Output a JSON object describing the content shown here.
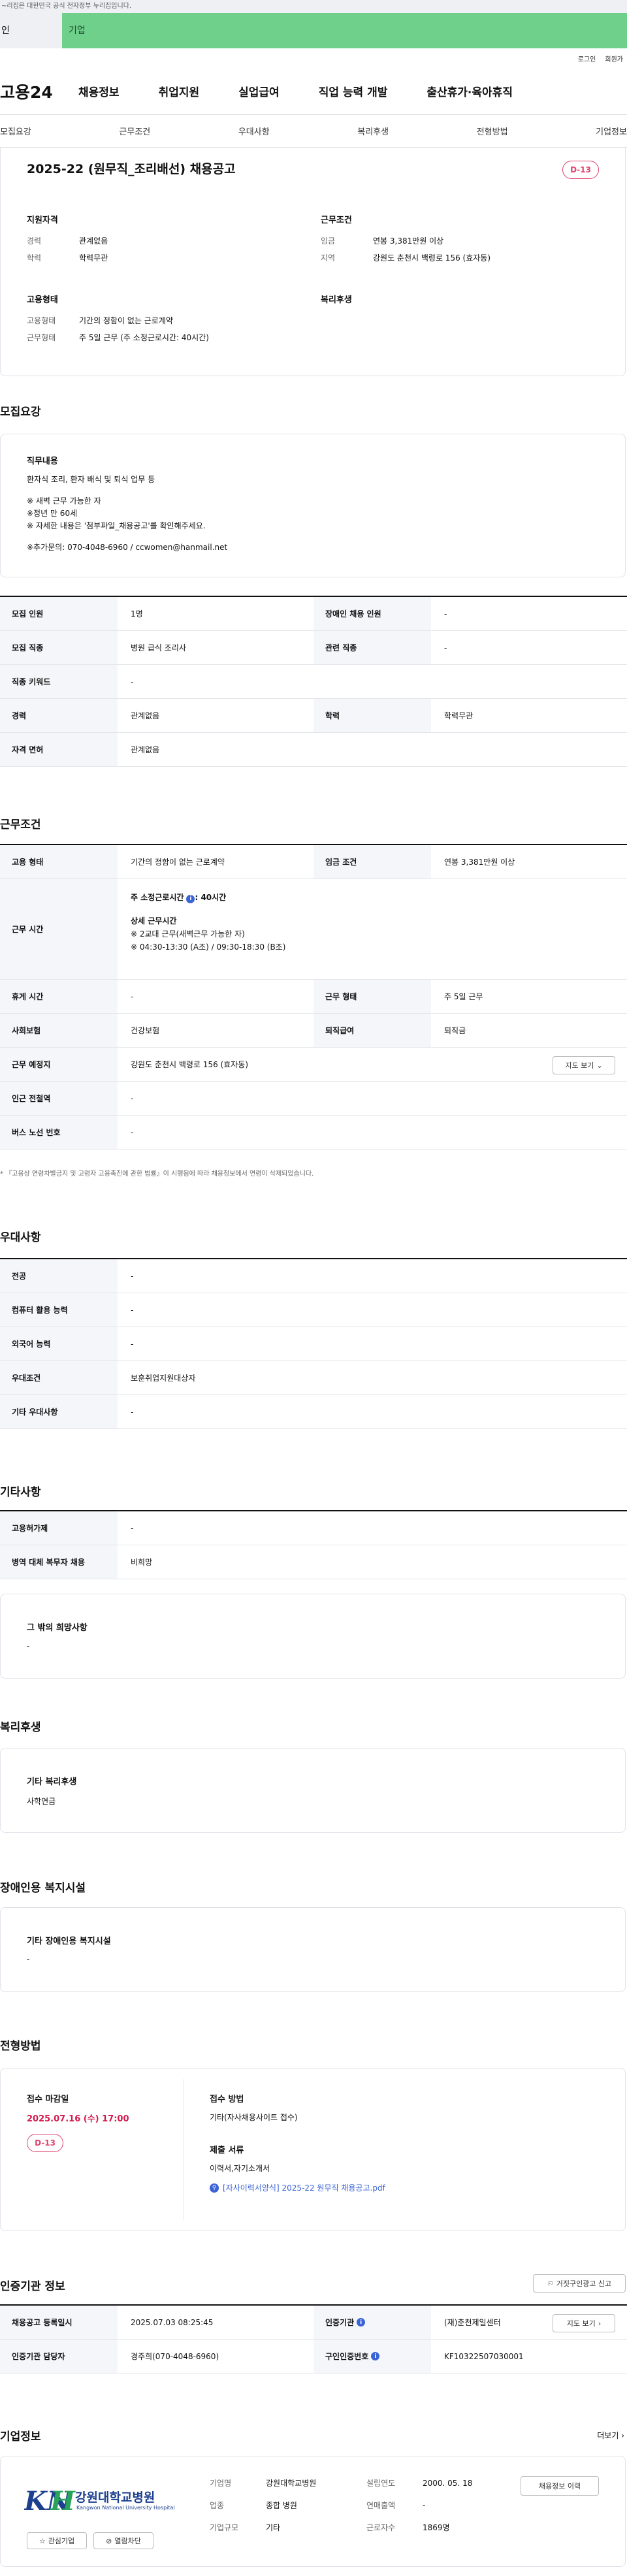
{
  "gov_banner": "~리집은 대한민국 공식 전자정부 누리집입니다.",
  "site_tabs": [
    "인",
    "기업"
  ],
  "util_links": [
    "로그인",
    "회원가"
  ],
  "logo": "고용24",
  "gnb": [
    "채용정보",
    "취업지원",
    "실업급여",
    "직업 능력 개발",
    "출산휴가·육아휴직"
  ],
  "anchors": [
    "모집요강",
    "근무조건",
    "우대사항",
    "복리후생",
    "전형방법",
    "기업정보"
  ],
  "summary": {
    "title": "2025-22 (원무직_조리배선) 채용공고",
    "dday": "D-13",
    "qual_h": "지원자격",
    "qual": [
      {
        "k": "경력",
        "v": "관계없음"
      },
      {
        "k": "학력",
        "v": "학력무관"
      }
    ],
    "cond_h": "근무조건",
    "cond": [
      {
        "k": "임금",
        "v": "연봉 3,381만원 이상"
      },
      {
        "k": "지역",
        "v": "강원도 춘천시 백령로 156 (효자동)"
      }
    ],
    "emp_h": "고용형태",
    "emp": [
      {
        "k": "고용형태",
        "v": "기간의 정함이 없는 근로계약"
      },
      {
        "k": "근무형태",
        "v": "주 5일 근무 (주 소정근로시간: 40시간)"
      }
    ],
    "welf_h": "복리후생"
  },
  "recruit": {
    "heading": "모집요강",
    "duty_h": "직무내용",
    "duty": [
      "환자식 조리, 환자 배식 및 퇴식 업무 등",
      "",
      "※ 새벽 근무 가능한 자",
      "※정년 만 60세",
      "※ 자세한 내용은 '첨부파일_채용공고'를 확인해주세요.",
      "",
      "※추가문의: 070-4048-6960 / ccwomen@hanmail.net"
    ],
    "rows": [
      {
        "k1": "모집 인원",
        "v1": "1명",
        "k2": "장애인 채용 인원",
        "v2": "-"
      },
      {
        "k1": "모집 직종",
        "v1": "병원 급식 조리사",
        "k2": "관련 직종",
        "v2": "-"
      },
      {
        "k1": "직종 키워드",
        "v1": "-"
      },
      {
        "k1": "경력",
        "v1": "관계없음",
        "k2": "학력",
        "v2": "학력무관"
      },
      {
        "k1": "자격 면허",
        "v1": "관계없음"
      }
    ]
  },
  "work": {
    "heading": "근무조건",
    "r1": {
      "k1": "고용 형태",
      "v1": "기간의 정함이 없는 근로계약",
      "k2": "임금 조건",
      "v2": "연봉 3,381만원 이상"
    },
    "time_k": "근무 시간",
    "time_main": "주 소정근로시간",
    "time_main_v": ": 40시간",
    "time_detail_h": "상세 근무시간",
    "time_detail": [
      "※ 2교대 근무(새벽근무 가능한 자)",
      "※ 04:30-13:30 (A조) / 09:30-18:30 (B조)"
    ],
    "r3": {
      "k1": "휴게 시간",
      "v1": "-",
      "k2": "근무 형태",
      "v2": "주 5일 근무"
    },
    "r4": {
      "k1": "사회보험",
      "v1": "건강보험",
      "k2": "퇴직급여",
      "v2": "퇴직금"
    },
    "loc_k": "근무 예정지",
    "loc_v": "강원도 춘천시 백령로 156 (효자동)",
    "map_btn": "지도 보기",
    "subway_k": "인근 전철역",
    "subway_v": "-",
    "bus_k": "버스 노선 번호",
    "bus_v": "-",
    "note": "* 『고용상 연령차별금지 및 고령자 고용촉진에 관한 법률』이 시행됨에 따라 채용정보에서 연령이 삭제되었습니다."
  },
  "pref": {
    "heading": "우대사항",
    "rows": [
      {
        "k": "전공",
        "v": "-"
      },
      {
        "k": "컴퓨터 활용 능력",
        "v": "-"
      },
      {
        "k": "외국어 능력",
        "v": "-"
      },
      {
        "k": "우대조건",
        "v": "보훈취업지원대상자"
      },
      {
        "k": "기타 우대사항",
        "v": "-"
      }
    ]
  },
  "etc": {
    "heading": "기타사항",
    "rows": [
      {
        "k": "고용허가제",
        "v": "-"
      },
      {
        "k": "병역 대체 복무자 채용",
        "v": "비희망"
      }
    ],
    "box_h": "그 밖의 희망사항",
    "box_v": "-"
  },
  "welfare": {
    "heading": "복리후생",
    "box_h": "기타 복리후생",
    "box_v": "사학연금"
  },
  "disab": {
    "heading": "장애인용 복지시설",
    "box_h": "기타 장애인용 복지시설",
    "box_v": "-"
  },
  "process": {
    "heading": "전형방법",
    "deadline_h": "접수 마감일",
    "deadline_v": "2025.07.16 (수) 17:00",
    "dday": "D-13",
    "method_h": "접수 방법",
    "method_v": "기타(자사채용사이트 접수)",
    "docs_h": "제출 서류",
    "docs_v": "이력서,자기소개서",
    "file": "[자사이력서양식] 2025-22 원무직 채용공고.pdf"
  },
  "cert": {
    "heading": "인증기관 정보",
    "report_btn": "거짓구인광고 신고",
    "r1": {
      "k1": "채용공고 등록일시",
      "v1": "2025.07.03 08:25:45",
      "k2": "인증기관",
      "v2": "(재)춘천제일센터",
      "btn": "지도 보기"
    },
    "r2": {
      "k1": "인증기관 담당자",
      "v1": "경주희(070-4048-6960)",
      "k2": "구인인증번호",
      "v2": "KF10322507030001"
    }
  },
  "company": {
    "heading": "기업정보",
    "more": "더보기",
    "logo_kr": "강원대학교병원",
    "logo_en": "Kangwon National University Hospital",
    "fields": [
      {
        "k": "기업명",
        "v": "강원대학교병원"
      },
      {
        "k": "업종",
        "v": "종합 병원"
      },
      {
        "k": "기업규모",
        "v": "기타"
      },
      {
        "k": "설립연도",
        "v": "2000. 05. 18"
      },
      {
        "k": "연매출액",
        "v": "-"
      },
      {
        "k": "근로자수",
        "v": "1869명"
      }
    ],
    "info_btn": "채용정보 이력",
    "fav_btn": "관심기업",
    "block_btn": "열람차단"
  },
  "colors": {
    "accent": "#6fd08c",
    "dday": "#e0436d",
    "link": "#3a63d6"
  }
}
